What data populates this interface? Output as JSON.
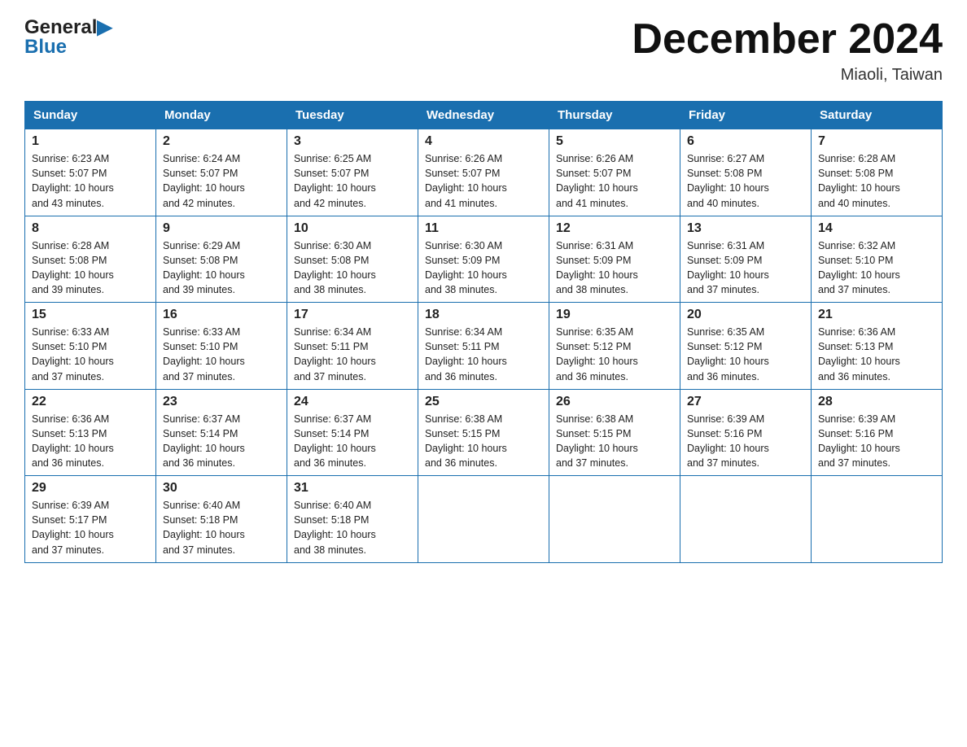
{
  "logo": {
    "text_general": "General",
    "text_blue": "Blue",
    "arrow": "▶"
  },
  "title": "December 2024",
  "location": "Miaoli, Taiwan",
  "days_of_week": [
    "Sunday",
    "Monday",
    "Tuesday",
    "Wednesday",
    "Thursday",
    "Friday",
    "Saturday"
  ],
  "weeks": [
    [
      {
        "day": "1",
        "sunrise": "6:23 AM",
        "sunset": "5:07 PM",
        "daylight": "10 hours and 43 minutes."
      },
      {
        "day": "2",
        "sunrise": "6:24 AM",
        "sunset": "5:07 PM",
        "daylight": "10 hours and 42 minutes."
      },
      {
        "day": "3",
        "sunrise": "6:25 AM",
        "sunset": "5:07 PM",
        "daylight": "10 hours and 42 minutes."
      },
      {
        "day": "4",
        "sunrise": "6:26 AM",
        "sunset": "5:07 PM",
        "daylight": "10 hours and 41 minutes."
      },
      {
        "day": "5",
        "sunrise": "6:26 AM",
        "sunset": "5:07 PM",
        "daylight": "10 hours and 41 minutes."
      },
      {
        "day": "6",
        "sunrise": "6:27 AM",
        "sunset": "5:08 PM",
        "daylight": "10 hours and 40 minutes."
      },
      {
        "day": "7",
        "sunrise": "6:28 AM",
        "sunset": "5:08 PM",
        "daylight": "10 hours and 40 minutes."
      }
    ],
    [
      {
        "day": "8",
        "sunrise": "6:28 AM",
        "sunset": "5:08 PM",
        "daylight": "10 hours and 39 minutes."
      },
      {
        "day": "9",
        "sunrise": "6:29 AM",
        "sunset": "5:08 PM",
        "daylight": "10 hours and 39 minutes."
      },
      {
        "day": "10",
        "sunrise": "6:30 AM",
        "sunset": "5:08 PM",
        "daylight": "10 hours and 38 minutes."
      },
      {
        "day": "11",
        "sunrise": "6:30 AM",
        "sunset": "5:09 PM",
        "daylight": "10 hours and 38 minutes."
      },
      {
        "day": "12",
        "sunrise": "6:31 AM",
        "sunset": "5:09 PM",
        "daylight": "10 hours and 38 minutes."
      },
      {
        "day": "13",
        "sunrise": "6:31 AM",
        "sunset": "5:09 PM",
        "daylight": "10 hours and 37 minutes."
      },
      {
        "day": "14",
        "sunrise": "6:32 AM",
        "sunset": "5:10 PM",
        "daylight": "10 hours and 37 minutes."
      }
    ],
    [
      {
        "day": "15",
        "sunrise": "6:33 AM",
        "sunset": "5:10 PM",
        "daylight": "10 hours and 37 minutes."
      },
      {
        "day": "16",
        "sunrise": "6:33 AM",
        "sunset": "5:10 PM",
        "daylight": "10 hours and 37 minutes."
      },
      {
        "day": "17",
        "sunrise": "6:34 AM",
        "sunset": "5:11 PM",
        "daylight": "10 hours and 37 minutes."
      },
      {
        "day": "18",
        "sunrise": "6:34 AM",
        "sunset": "5:11 PM",
        "daylight": "10 hours and 36 minutes."
      },
      {
        "day": "19",
        "sunrise": "6:35 AM",
        "sunset": "5:12 PM",
        "daylight": "10 hours and 36 minutes."
      },
      {
        "day": "20",
        "sunrise": "6:35 AM",
        "sunset": "5:12 PM",
        "daylight": "10 hours and 36 minutes."
      },
      {
        "day": "21",
        "sunrise": "6:36 AM",
        "sunset": "5:13 PM",
        "daylight": "10 hours and 36 minutes."
      }
    ],
    [
      {
        "day": "22",
        "sunrise": "6:36 AM",
        "sunset": "5:13 PM",
        "daylight": "10 hours and 36 minutes."
      },
      {
        "day": "23",
        "sunrise": "6:37 AM",
        "sunset": "5:14 PM",
        "daylight": "10 hours and 36 minutes."
      },
      {
        "day": "24",
        "sunrise": "6:37 AM",
        "sunset": "5:14 PM",
        "daylight": "10 hours and 36 minutes."
      },
      {
        "day": "25",
        "sunrise": "6:38 AM",
        "sunset": "5:15 PM",
        "daylight": "10 hours and 36 minutes."
      },
      {
        "day": "26",
        "sunrise": "6:38 AM",
        "sunset": "5:15 PM",
        "daylight": "10 hours and 37 minutes."
      },
      {
        "day": "27",
        "sunrise": "6:39 AM",
        "sunset": "5:16 PM",
        "daylight": "10 hours and 37 minutes."
      },
      {
        "day": "28",
        "sunrise": "6:39 AM",
        "sunset": "5:16 PM",
        "daylight": "10 hours and 37 minutes."
      }
    ],
    [
      {
        "day": "29",
        "sunrise": "6:39 AM",
        "sunset": "5:17 PM",
        "daylight": "10 hours and 37 minutes."
      },
      {
        "day": "30",
        "sunrise": "6:40 AM",
        "sunset": "5:18 PM",
        "daylight": "10 hours and 37 minutes."
      },
      {
        "day": "31",
        "sunrise": "6:40 AM",
        "sunset": "5:18 PM",
        "daylight": "10 hours and 38 minutes."
      },
      null,
      null,
      null,
      null
    ]
  ],
  "labels": {
    "sunrise": "Sunrise:",
    "sunset": "Sunset:",
    "daylight": "Daylight:"
  }
}
